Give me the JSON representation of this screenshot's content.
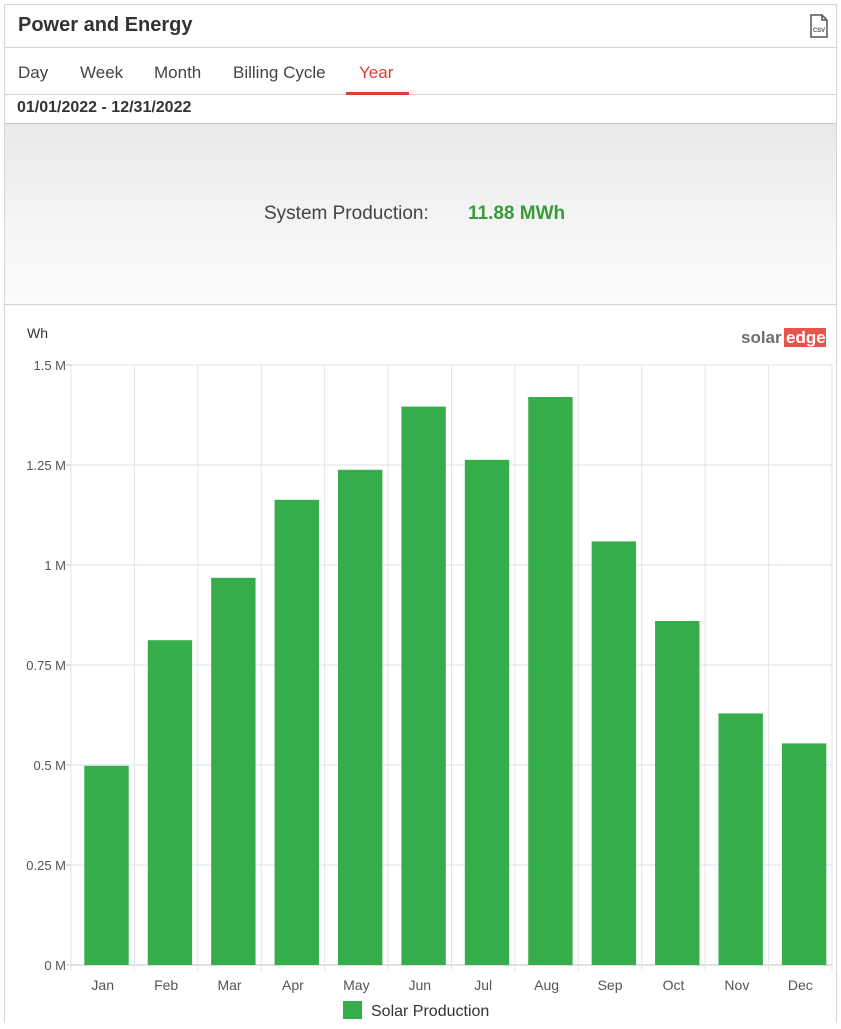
{
  "header": {
    "title": "Power and Energy",
    "csv_icon": "csv-file-icon"
  },
  "tabs": [
    {
      "label": "Day",
      "active": false
    },
    {
      "label": "Week",
      "active": false
    },
    {
      "label": "Month",
      "active": false
    },
    {
      "label": "Billing Cycle",
      "active": false
    },
    {
      "label": "Year",
      "active": true
    }
  ],
  "date_range": "01/01/2022 - 12/31/2022",
  "summary": {
    "label": "System Production:",
    "value": "11.88 MWh"
  },
  "brand": {
    "logo_text_left": "solar",
    "logo_text_right": "edge",
    "logo_color_left": "#6d6e71",
    "logo_color_right": "#e8534a"
  },
  "colors": {
    "accent": "#e03c31",
    "bar": "#34ad4a",
    "value_green": "#3a9b3a"
  },
  "chart_data": {
    "type": "bar",
    "ylabel": "Wh",
    "categories": [
      "Jan",
      "Feb",
      "Mar",
      "Apr",
      "May",
      "Jun",
      "Jul",
      "Aug",
      "Sep",
      "Oct",
      "Nov",
      "Dec"
    ],
    "series": [
      {
        "name": "Solar Production",
        "values": [
          498000,
          812000,
          968000,
          1163000,
          1238000,
          1396000,
          1263000,
          1420000,
          1059000,
          860000,
          629000,
          554000
        ]
      }
    ],
    "ylim": [
      0,
      1500000
    ],
    "yticks": [
      0,
      250000,
      500000,
      750000,
      1000000,
      1250000,
      1500000
    ],
    "ytick_labels": [
      "0 M",
      "0.25 M",
      "0.5 M",
      "0.75 M",
      "1 M",
      "1.25 M",
      "1.5 M"
    ],
    "grid": true,
    "legend": "bottom-center"
  }
}
